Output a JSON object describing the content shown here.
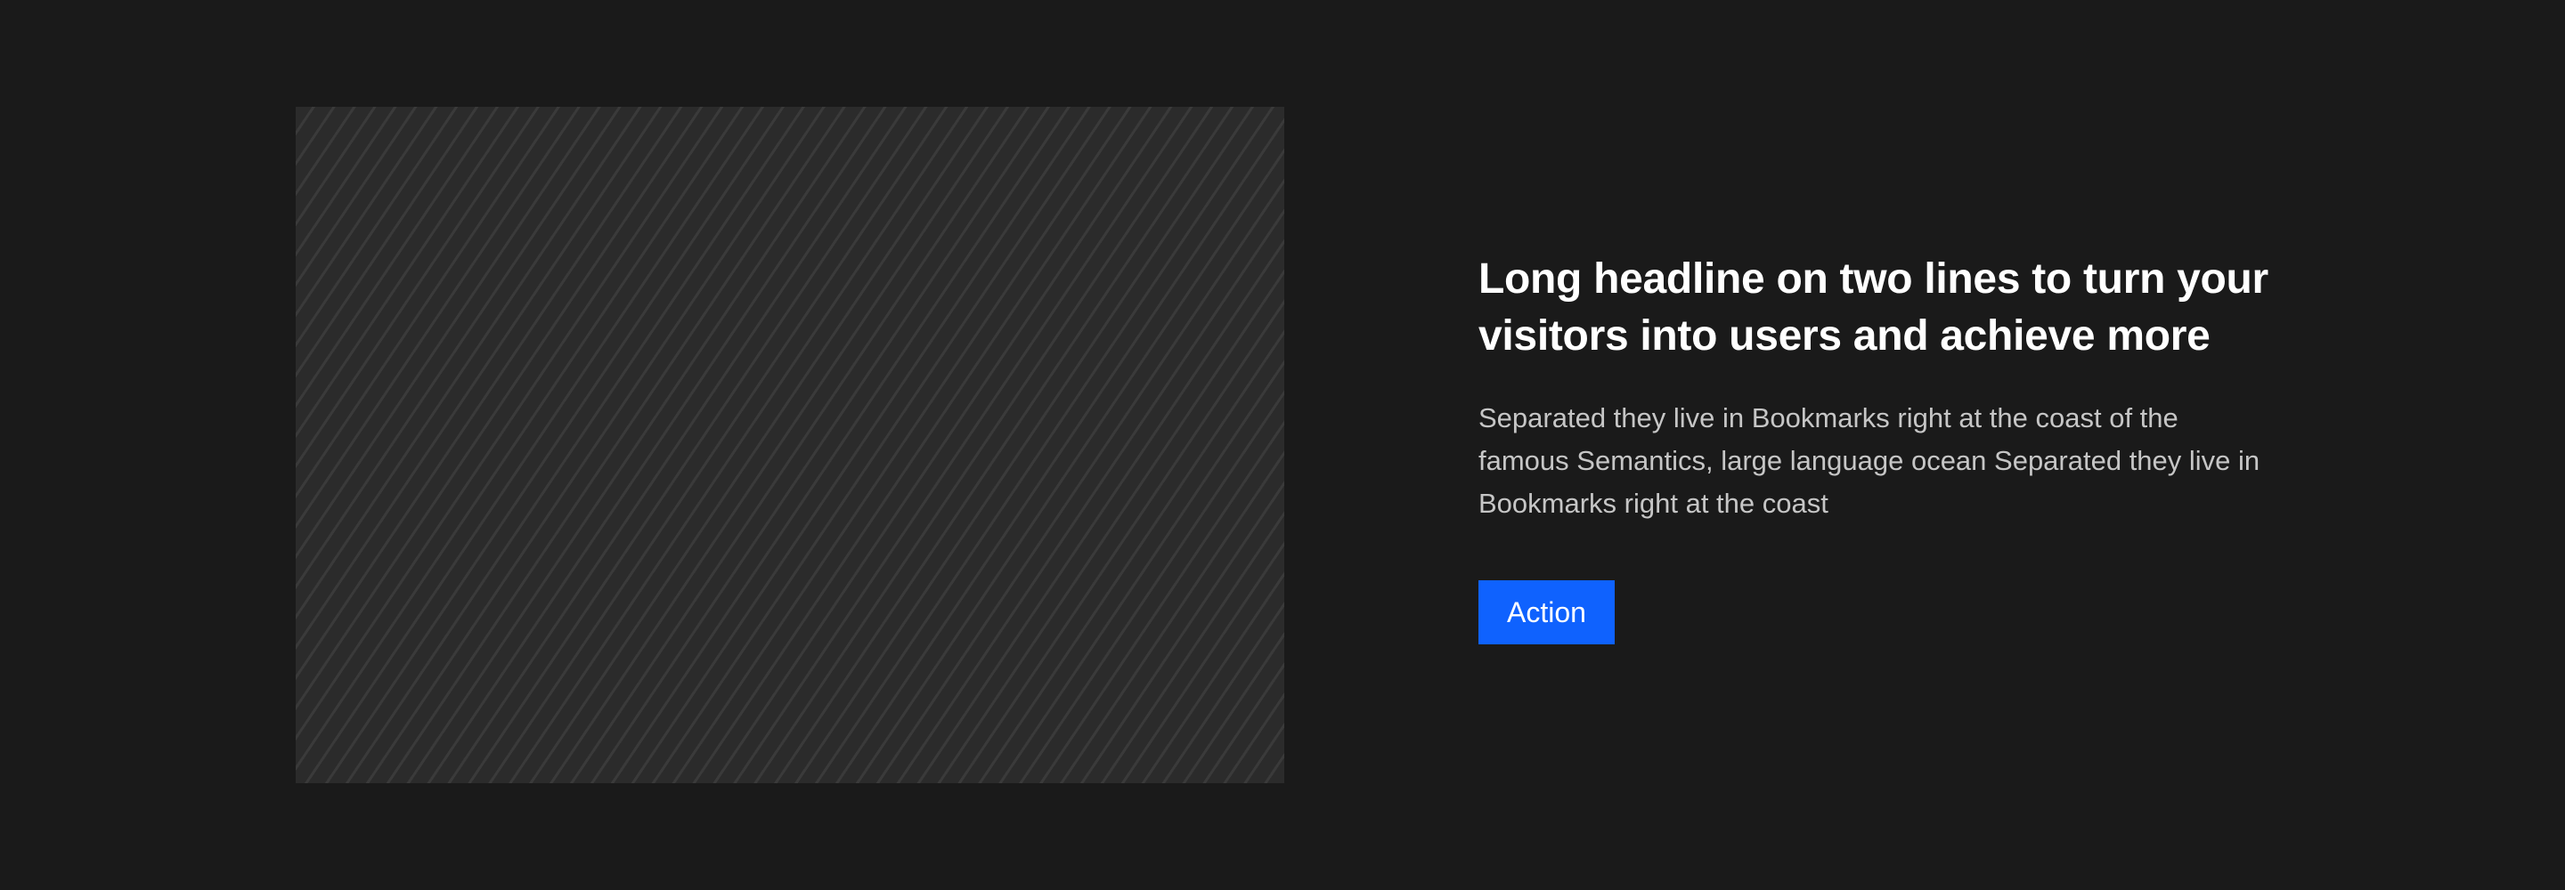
{
  "hero": {
    "headline": "Long headline on two lines to turn your visitors into users and achieve more",
    "body": "Separated they live in Bookmarks right at the coast of the famous Semantics, large language ocean Separated they live in Bookmarks right at the coast",
    "action_label": "Action"
  },
  "colors": {
    "background": "#1a1a1a",
    "headline": "#ffffff",
    "body": "#c6c6c6",
    "button": "#0f62fe",
    "placeholder": "#2b2b2b"
  }
}
